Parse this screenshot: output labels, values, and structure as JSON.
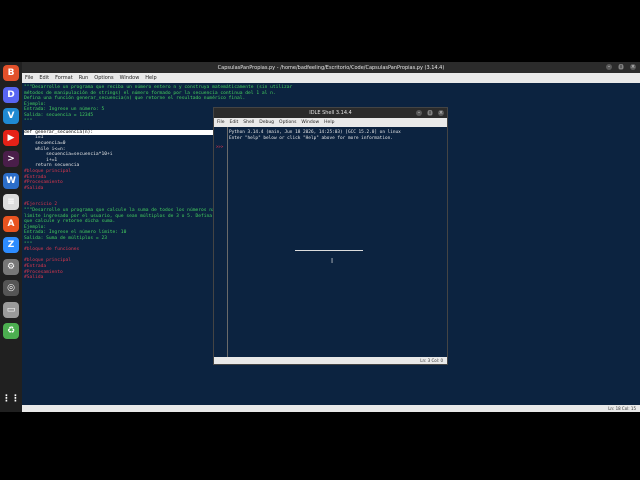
{
  "editor": {
    "title": "CapsulasPanPropias.py - /home/badfeeling/Escritorio/Code/CapsulasPanPropias.py (3.14.4)",
    "menu": [
      "File",
      "Edit",
      "Format",
      "Run",
      "Options",
      "Window",
      "Help"
    ],
    "status": "Ln: 18  Col: 15",
    "code_lines": [
      {
        "text": "\"\"\"Desarrolle un programa que reciba un número entero n y construya matemáticamente (sin utilizar",
        "color": "green"
      },
      {
        "text": "métodos de manipulación de strings) el número formado por la secuencia continua del 1 al n.",
        "color": "green"
      },
      {
        "text": "Defina una función generar_secuencia(n) que retorne el resultado numérico final.",
        "color": "green"
      },
      {
        "text": "Ejemplo:",
        "color": "green"
      },
      {
        "text": "Entrada: Ingrese un número: 5",
        "color": "green"
      },
      {
        "text": "Salida: secuencia = 12345",
        "color": "green"
      },
      {
        "text": "\"\"\"",
        "color": "green"
      },
      {
        "text": "",
        "color": "white"
      },
      {
        "text": "def generar_secuencia(n):",
        "color": "white",
        "cursor": true
      },
      {
        "text": "    i=1",
        "color": "white"
      },
      {
        "text": "    secuencia=0",
        "color": "white"
      },
      {
        "text": "    while i<=n:",
        "color": "white"
      },
      {
        "text": "        secuencia=secuencia*10+i",
        "color": "white"
      },
      {
        "text": "        i+=1",
        "color": "white"
      },
      {
        "text": "    return secuencia",
        "color": "white"
      },
      {
        "text": "#bloque principal",
        "color": "red"
      },
      {
        "text": "#Entrada",
        "color": "red"
      },
      {
        "text": "#Procesamiento",
        "color": "red"
      },
      {
        "text": "#Salida",
        "color": "red"
      },
      {
        "text": "",
        "color": "white"
      },
      {
        "text": "",
        "color": "white"
      },
      {
        "text": "#Ejercicio 2",
        "color": "red"
      },
      {
        "text": "\"\"\"Desarrolle un programa que calcule la suma de todos los números naturales por debajo de un",
        "color": "green"
      },
      {
        "text": "límite ingresado por el usuario, que sean múltiplos de 3 o 5. Defina una función suma_",
        "color": "green"
      },
      {
        "text": "que calcule y retorne dicha suma.",
        "color": "green"
      },
      {
        "text": "Ejemplo:",
        "color": "green"
      },
      {
        "text": "Entrada: Ingrese el número límite: 10",
        "color": "green"
      },
      {
        "text": "Salida: Suma de múltiplos = 23",
        "color": "green"
      },
      {
        "text": "\"\"\"",
        "color": "green"
      },
      {
        "text": "#bloque de funciones",
        "color": "red"
      },
      {
        "text": "",
        "color": "white"
      },
      {
        "text": "#bloque principal",
        "color": "red"
      },
      {
        "text": "#Entrada",
        "color": "red"
      },
      {
        "text": "#Procesamiento",
        "color": "red"
      },
      {
        "text": "#Salida",
        "color": "red"
      }
    ]
  },
  "shell": {
    "title": "IDLE Shell 3.14.4",
    "menu": [
      "File",
      "Edit",
      "Shell",
      "Debug",
      "Options",
      "Window",
      "Help"
    ],
    "prompt": ">>>",
    "banner_line1": "Python 3.14.4 (main, Jun 18 2026, 14:25:03) [GCC 15.2.0] on linux",
    "banner_line2": "Enter \"help\" below or click \"Help\" above for more information.",
    "status": "Ln: 3  Col: 0"
  },
  "colors": {
    "editor_bg": "#0c2340",
    "comment_green": "#45d35f",
    "comment_red": "#e0374d"
  },
  "dock_icons": [
    {
      "name": "brave-browser-icon",
      "color": "#e2512b",
      "glyph": "B"
    },
    {
      "name": "discord-icon",
      "color": "#5865f2",
      "glyph": "D"
    },
    {
      "name": "vscode-icon",
      "color": "#1f8ad2",
      "glyph": "V"
    },
    {
      "name": "youtube-icon",
      "color": "#e62117",
      "glyph": "▶"
    },
    {
      "name": "terminal-icon",
      "color": "#4a1e4a",
      "glyph": ">"
    },
    {
      "name": "writer-icon",
      "color": "#2c6ec9",
      "glyph": "W"
    },
    {
      "name": "notes-icon",
      "color": "#dddddd",
      "glyph": "≡"
    },
    {
      "name": "software-store-icon",
      "color": "#e95420",
      "glyph": "A"
    },
    {
      "name": "zoom-icon",
      "color": "#2d8cff",
      "glyph": "Z"
    },
    {
      "name": "settings-icon",
      "color": "#777777",
      "glyph": "⚙"
    },
    {
      "name": "recorder-icon",
      "color": "#555555",
      "glyph": "◎"
    },
    {
      "name": "files-icon",
      "color": "#9a9a9a",
      "glyph": "▭"
    },
    {
      "name": "trash-icon",
      "color": "#4caf50",
      "glyph": "♻"
    },
    {
      "name": "apps-grid-icon",
      "color": "#202020",
      "glyph": "⋮⋮"
    }
  ]
}
